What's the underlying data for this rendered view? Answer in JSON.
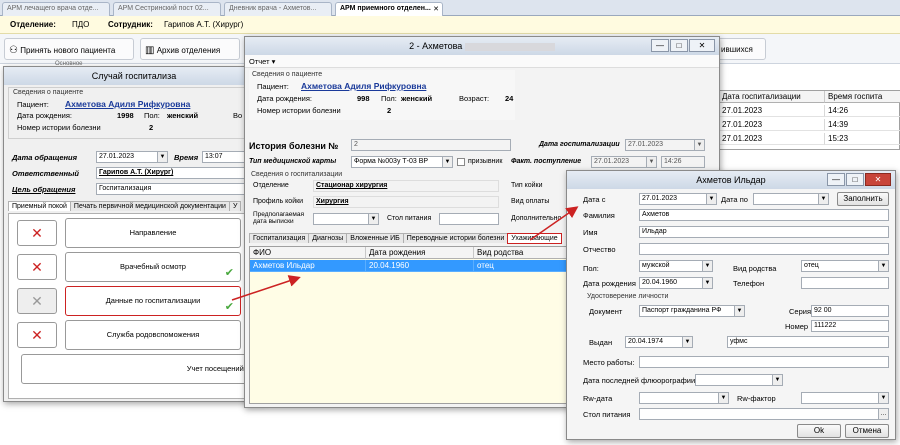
{
  "browser_tabs": [
    "АРМ лечащего врача отде...",
    "АРМ Сестринский пост 02...",
    "Дневник врача - Ахметов...",
    "АРМ приемного отделен..."
  ],
  "active_tab_close": "✕",
  "infobar": {
    "dept_label": "Отделение:",
    "dept_value": "ПДО",
    "staff_label": "Сотрудник:",
    "staff_value": "Гарипов А.Т. (Хирург)"
  },
  "toolbar": {
    "accept_label": "Принять нового пациента",
    "archive_label": "Архив отделения",
    "group_label": "Основное",
    "right_fragment": "ившихся"
  },
  "case_win": {
    "title": "Случай госпитализа",
    "patient_section": "Сведения о пациенте",
    "patient_label": "Пациент:",
    "patient_name": "Ахметова Адиля Рифкуровна",
    "dob_label": "Дата рождения:",
    "dob_value": "1998",
    "sex_label": "Пол:",
    "sex_value": "женский",
    "age_frag": "Во",
    "history_label": "Номер истории болезни",
    "history_value": "2",
    "appeal_date_label": "Дата обращения",
    "appeal_date": "27.01.2023",
    "time_label": "Время",
    "time_value": "13:07",
    "responsible_label": "Ответственный",
    "responsible_value": "Гарипов А.Т. (Хирург)",
    "purpose_label": "Цель обращения",
    "purpose_value": "Госпитализация",
    "tabs": [
      "Приемный покой",
      "Печать первичной медицинской документации",
      "У"
    ],
    "buttons": [
      "Направление",
      "Врачебный осмотр",
      "Данные по госпитализации",
      "Служба родовспоможения"
    ],
    "visits_label": "Учет посещений в п"
  },
  "history_win": {
    "title": "2 - Ахметова",
    "menu_report": "Отчет ▾",
    "patient_section": "Сведения о пациенте",
    "patient_label": "Пациент:",
    "patient_name": "Ахметова Адиля Рифкуровна",
    "dob_label": "Дата рождения:",
    "dob_value": "998",
    "sex_label": "Пол:",
    "sex_value": "женский",
    "age_label": "Возраст:",
    "age_value": "24",
    "history_label": "Номер истории болезни",
    "history_value": "2",
    "hist_no_label": "История болезни №",
    "hist_no_value": "2",
    "hosp_date_label": "Дата госпитализации",
    "hosp_date": "27.01.2023",
    "card_type_label": "Тип медицинской карты",
    "card_type_value": "Форма №003у Т-03 ВР",
    "conscript_label": "призывник",
    "admit_label": "Факт. поступление",
    "admit_date": "27.01.2023",
    "admit_time": "14:26",
    "hosp_section": "Сведения о госпитализации",
    "dept_label": "Отделение",
    "dept_value": "Стационар хирургия",
    "bed_type_label": "Тип койки",
    "profile_label": "Профиль койки",
    "profile_value": "Хирургия",
    "pay_label": "Вид оплаты",
    "discharge_label": "Предполагаемая дата выписки",
    "table_label": "Стол питания",
    "extra_label": "Дополнительно",
    "tabs": [
      "Госпитализация",
      "Диагнозы",
      "Вложенные ИБ",
      "Переводные истории болезни",
      "Ухаживающие"
    ],
    "grid_headers": [
      "ФИО",
      "Дата рождения",
      "Вид родства"
    ],
    "grid_rows": [
      {
        "fio": "Ахметов Ильдар",
        "dob": "20.04.1960",
        "rel": "отец"
      }
    ]
  },
  "right_grid": {
    "headers": [
      "Дата госпитализации",
      "Время госпита"
    ],
    "rows": [
      {
        "date": "27.01.2023",
        "time": "14:26"
      },
      {
        "date": "27.01.2023",
        "time": "14:39"
      },
      {
        "date": "27.01.2023",
        "time": "15:23"
      }
    ]
  },
  "caregiver_win": {
    "title": "Ахметов Ильдар",
    "date_from_label": "Дата с",
    "date_from": "27.01.2023",
    "date_to_label": "Дата по",
    "fill_btn": "Заполнить",
    "surname_label": "Фамилия",
    "surname": "Ахметов",
    "name_label": "Имя",
    "name": "Ильдар",
    "patronymic_label": "Отчество",
    "sex_label": "Пол:",
    "sex": "мужской",
    "rel_label": "Вид родства",
    "rel": "отец",
    "dob_label": "Дата рождения",
    "dob": "20.04.1960",
    "phone_label": "Телефон",
    "id_section": "Удостоверение личности",
    "doc_label": "Документ",
    "doc": "Паспорт гражданина РФ",
    "series_label": "Серия",
    "series": "92 00",
    "number_label": "Номер",
    "number": "111222",
    "issued_label": "Выдан",
    "issued_date": "20.04.1974",
    "issued_by": "уфмс",
    "work_label": "Место работы:",
    "fluoro_label": "Дата последней флюорографии:",
    "rw_date_label": "Rw-дата",
    "rw_factor_label": "Rw-фактор",
    "table_label": "Стол питания",
    "ok": "Ok",
    "cancel": "Отмена"
  },
  "colors": {
    "accent": "#3399ff",
    "red": "#cc2222",
    "link": "#1a3a9a",
    "check": "#49a83e"
  }
}
